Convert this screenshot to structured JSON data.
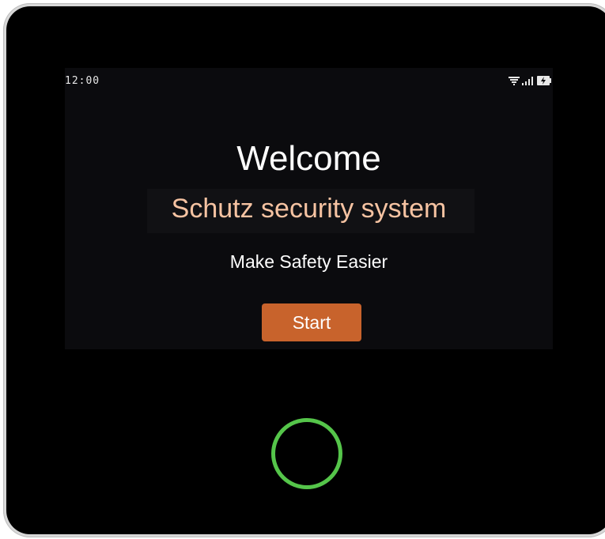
{
  "status_bar": {
    "time": "12:00",
    "icons": [
      "wifi-icon",
      "signal-icon",
      "battery-charging-icon"
    ]
  },
  "welcome": {
    "title": "Welcome",
    "brand": "Schutz security system",
    "tagline": "Make Safety Easier",
    "start_label": "Start"
  },
  "colors": {
    "accent": "#c8632c",
    "brand_text": "#f6c3a2",
    "ring": "#55c54a",
    "bezel": "#000000"
  }
}
